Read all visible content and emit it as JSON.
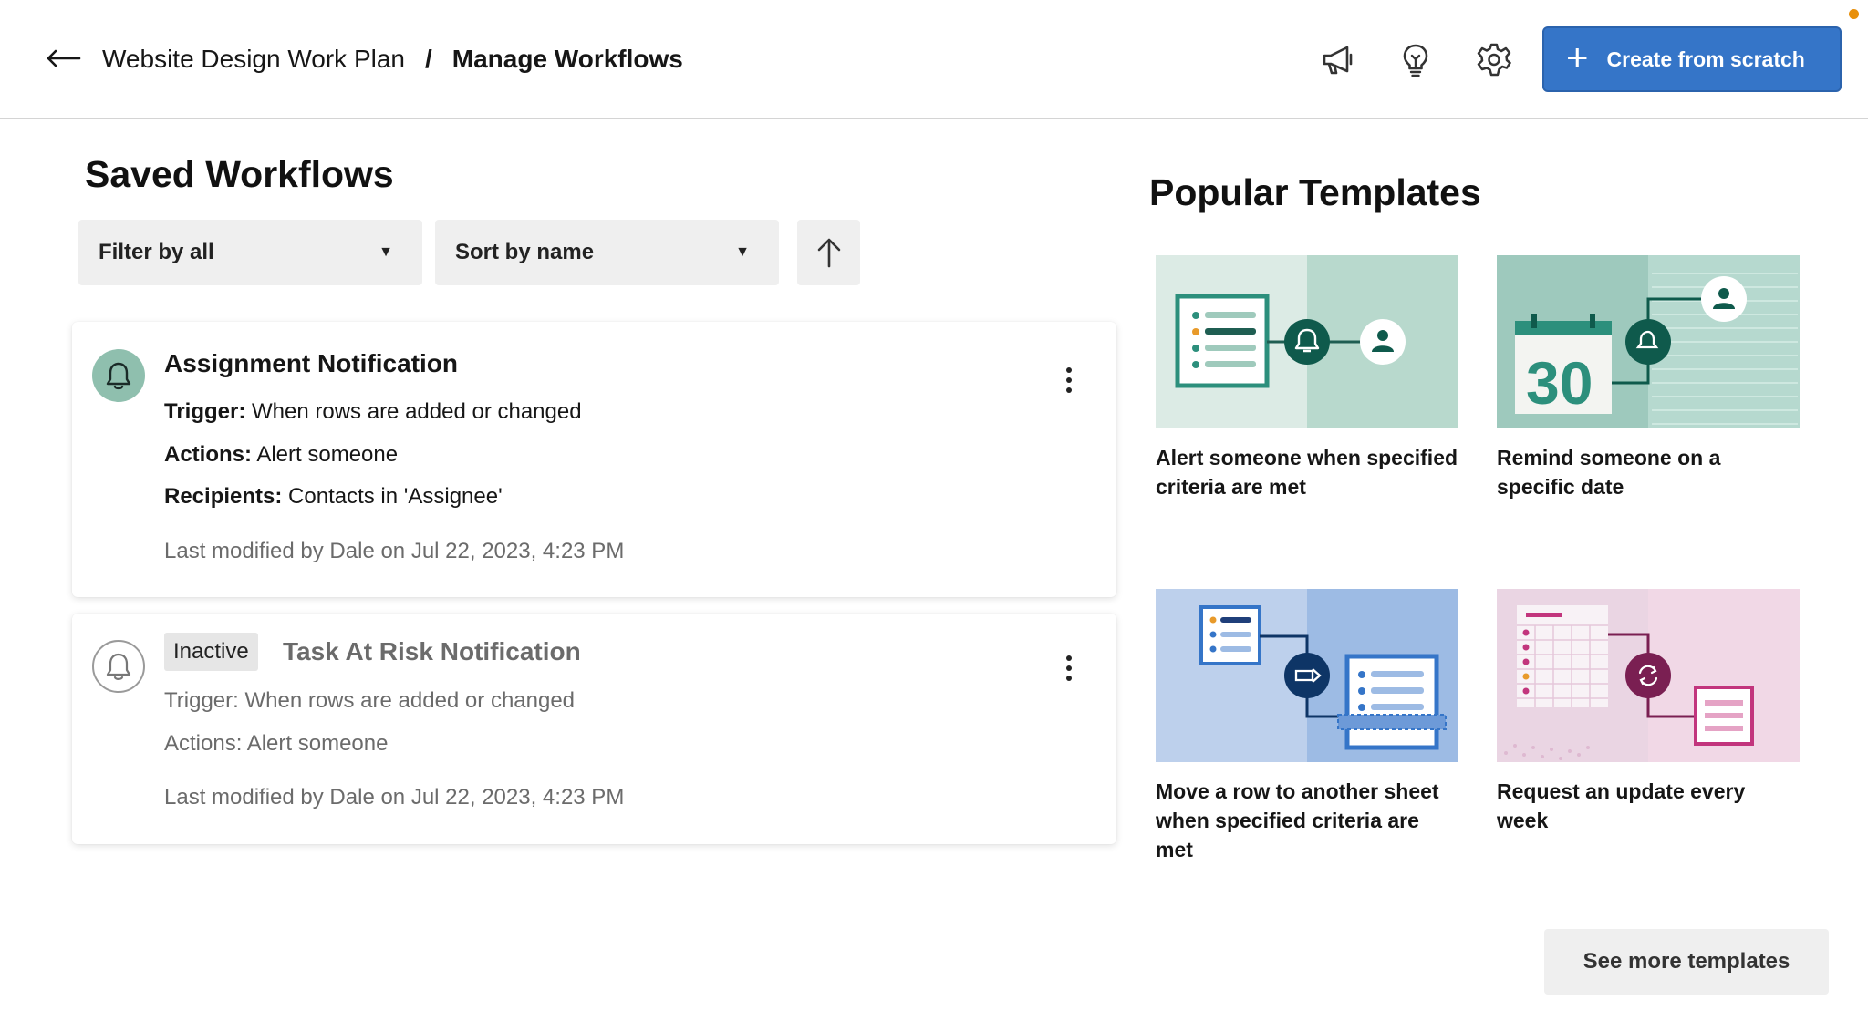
{
  "header": {
    "breadcrumb_parent": "Website Design Work Plan",
    "breadcrumb_separator": "/",
    "breadcrumb_current": "Manage Workflows",
    "icons": [
      "megaphone-icon",
      "lightbulb-icon",
      "gear-icon"
    ],
    "create_button": {
      "icon": "+",
      "label": "Create from scratch"
    },
    "accent_color": "#3575c8"
  },
  "saved": {
    "title": "Saved Workflows",
    "filter_label": "Filter by all",
    "sort_label": "Sort by name",
    "sort_caret": "▼"
  },
  "workflows": [
    {
      "name": "Assignment Notification",
      "status": "active",
      "trigger_label": "Trigger:",
      "trigger": "When rows are added or changed",
      "actions_label": "Actions:",
      "actions": "Alert someone",
      "recipients_label": "Recipients:",
      "recipients": "Contacts in 'Assignee'",
      "modified": "Last modified by Dale on Jul 22, 2023, 4:23 PM"
    },
    {
      "name": "Task At Risk Notification",
      "status": "inactive",
      "badge": "Inactive",
      "trigger_label": "Trigger:",
      "trigger": "When rows are added or changed",
      "actions_label": "Actions:",
      "actions": "Alert someone",
      "modified": "Last modified by Dale on Jul 22, 2023, 4:23 PM"
    }
  ],
  "templates": {
    "title": "Popular Templates",
    "items": [
      {
        "label": "Alert someone when specified criteria are met"
      },
      {
        "label": "Remind someone on a specific date",
        "calendar_number": "30"
      },
      {
        "label": "Move a row to another sheet when specified criteria are met"
      },
      {
        "label": "Request an update every week"
      }
    ],
    "see_more": "See more templates"
  }
}
